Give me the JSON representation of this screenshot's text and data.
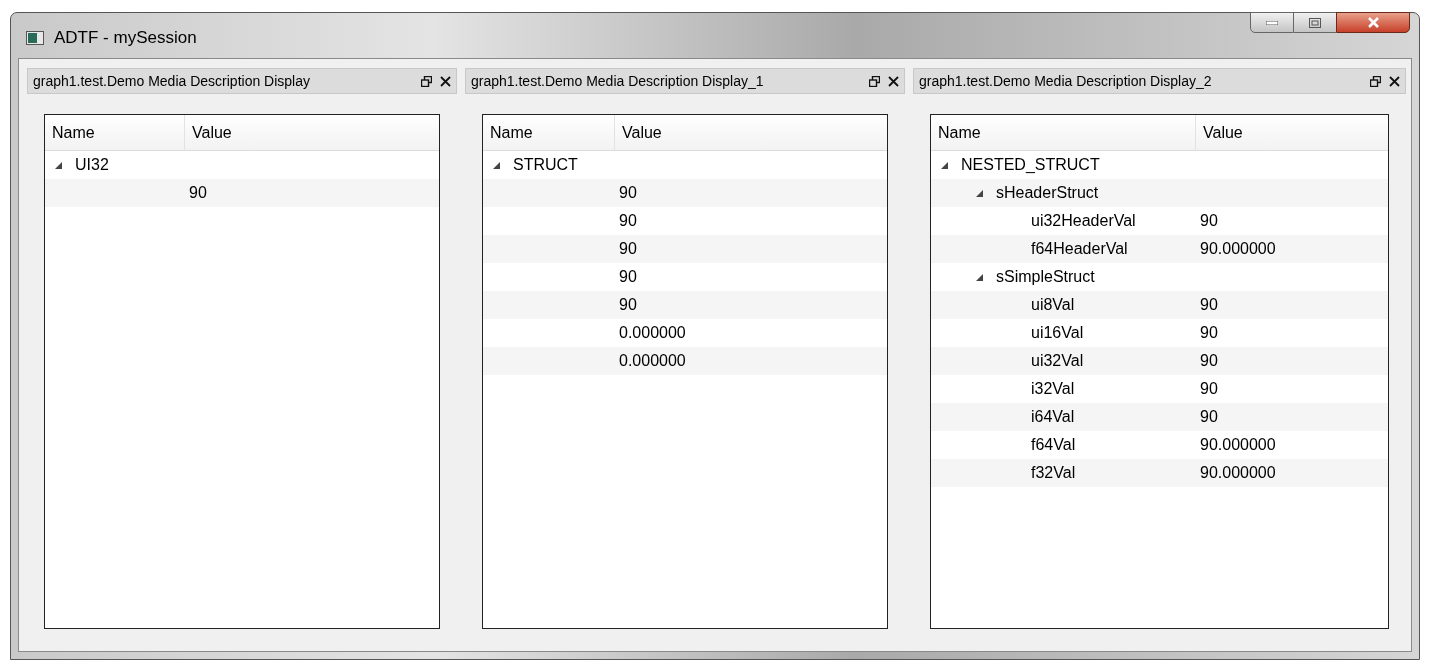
{
  "window": {
    "title": "ADTF - mySession"
  },
  "panels": [
    {
      "title": "graph1.test.Demo Media Description Display",
      "columns": [
        "Name",
        "Value"
      ],
      "rows": [
        {
          "name": "UI32",
          "expanded": true,
          "children": [
            {
              "value": "90"
            }
          ]
        }
      ]
    },
    {
      "title": "graph1.test.Demo Media Description Display_1",
      "columns": [
        "Name",
        "Value"
      ],
      "rows": [
        {
          "name": "STRUCT",
          "expanded": true,
          "children": [
            {
              "value": "90"
            },
            {
              "value": "90"
            },
            {
              "value": "90"
            },
            {
              "value": "90"
            },
            {
              "value": "90"
            },
            {
              "value": "0.000000"
            },
            {
              "value": "0.000000"
            }
          ]
        }
      ]
    },
    {
      "title": "graph1.test.Demo Media Description Display_2",
      "columns": [
        "Name",
        "Value"
      ],
      "rows": [
        {
          "name": "NESTED_STRUCT",
          "expanded": true,
          "children": [
            {
              "name": "sHeaderStruct",
              "expanded": true,
              "children": [
                {
                  "name": "ui32HeaderVal",
                  "value": "90"
                },
                {
                  "name": "f64HeaderVal",
                  "value": "90.000000"
                }
              ]
            },
            {
              "name": "sSimpleStruct",
              "expanded": true,
              "children": [
                {
                  "name": "ui8Val",
                  "value": "90"
                },
                {
                  "name": "ui16Val",
                  "value": "90"
                },
                {
                  "name": "ui32Val",
                  "value": "90"
                },
                {
                  "name": "i32Val",
                  "value": "90"
                },
                {
                  "name": "i64Val",
                  "value": "90"
                },
                {
                  "name": "f64Val",
                  "value": "90.000000"
                },
                {
                  "name": "f32Val",
                  "value": "90.000000"
                }
              ]
            }
          ]
        }
      ]
    }
  ]
}
